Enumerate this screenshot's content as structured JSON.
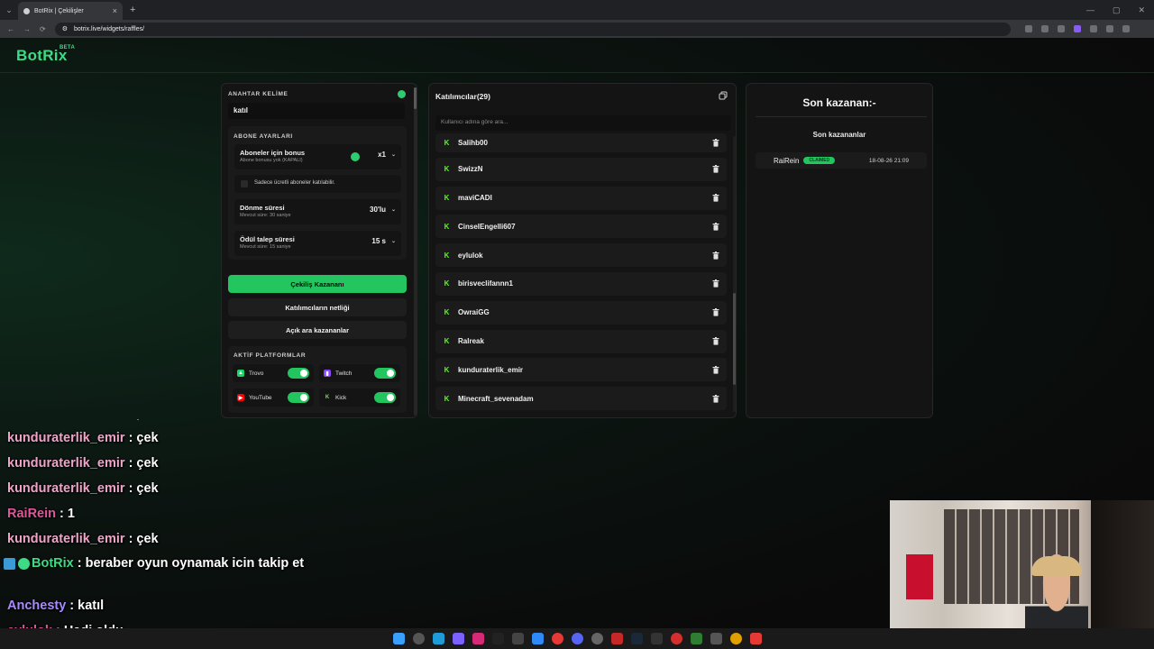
{
  "browser": {
    "tab_title": "BotRix | Çekilişler",
    "url": "botrix.live/widgets/raffles/"
  },
  "brand": {
    "name": "BotRix",
    "tag": "BETA",
    "color": "#3ddc84"
  },
  "keyword": {
    "label": "ANAHTAR KELİME",
    "value": "katıl"
  },
  "subscriber": {
    "label": "ABONE AYARLARI",
    "bonus_title": "Aboneler için bonus",
    "bonus_sub": "Abone bonusu yok (KAPALI)",
    "bonus_value": "x1",
    "only_paid_label": "Sadece ücretli aboneler katılabilir.",
    "spin_title": "Dönme süresi",
    "spin_sub": "Mevcut süre: 30 saniye",
    "spin_value": "30'lu",
    "claim_title": "Ödül talep süresi",
    "claim_sub": "Mevcut süre: 15 saniye",
    "claim_value": "15 s"
  },
  "buttons": {
    "draw": "Çekiliş Kazananı",
    "clear": "Katılımcıların netliği",
    "open_winners": "Açık ara kazananlar"
  },
  "platforms": {
    "label": "AKTİF PLATFORMLAR",
    "items": [
      {
        "name": "Trovo",
        "enabled": true,
        "icon": "trovo-icon",
        "color": "#19d66b"
      },
      {
        "name": "Twitch",
        "enabled": true,
        "icon": "twitch-icon",
        "color": "#9146ff"
      },
      {
        "name": "YouTube",
        "enabled": true,
        "icon": "youtube-icon",
        "color": "#ff0000"
      },
      {
        "name": "Kick",
        "enabled": true,
        "icon": "kick-icon",
        "color": "#53fc18"
      }
    ]
  },
  "participants": {
    "title": "Katılımcılar(29)",
    "search_placeholder": "Kullanıcı adına göre ara...",
    "list": [
      "Salihb00",
      "SwizzN",
      "maviCADI",
      "CinselEngelli607",
      "eylulok",
      "birisveclifannn1",
      "OwraiGG",
      "Ralreak",
      "kunduraterlik_emir",
      "Minecraft_sevenadam"
    ]
  },
  "winner": {
    "title": "Son kazanan:-",
    "sub": "Son kazananlar",
    "name": "RaiRein",
    "badge": "CLAIMED",
    "date": "18-08-26 21:09"
  },
  "chat": [
    {
      "user": "kunduraterlik_emir",
      "color": "#f0a3c8",
      "text": ": çek"
    },
    {
      "user": "kunduraterlik_emir",
      "color": "#f0a3c8",
      "text": ": çek"
    },
    {
      "user": "kunduraterlik_emir",
      "color": "#f0a3c8",
      "text": ": çek"
    },
    {
      "user": "RaiRein",
      "color": "#e0569b",
      "text": ": 1"
    },
    {
      "user": "kunduraterlik_emir",
      "color": "#f0a3c8",
      "text": ": çek"
    },
    {
      "user": "BotRix",
      "color": "#3ddc84",
      "text": ": beraber oyun oynamak icin takip et",
      "bot": true
    },
    {
      "user": "Anchesty",
      "color": "#a78bfa",
      "text": ": katıl"
    },
    {
      "user": "eylulok",
      "color": "#e0569b",
      "text": ": Hadi oldu"
    }
  ]
}
